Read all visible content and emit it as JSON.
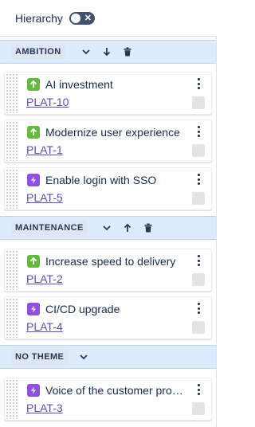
{
  "hierarchy": {
    "label": "Hierarchy",
    "toggle_symbol": "✕"
  },
  "groups": [
    {
      "name": "AMBITION",
      "icons": [
        "chevron-down-icon",
        "arrow-down-icon",
        "trash-icon"
      ],
      "items": [
        {
          "type": "story",
          "title": "AI investment",
          "key": "PLAT-10"
        },
        {
          "type": "story",
          "title": "Modernize user experience",
          "key": "PLAT-1"
        },
        {
          "type": "epic",
          "title": "Enable login with SSO",
          "key": "PLAT-5"
        }
      ]
    },
    {
      "name": "MAINTENANCE",
      "icons": [
        "chevron-down-icon",
        "arrow-up-icon",
        "trash-icon"
      ],
      "items": [
        {
          "type": "story",
          "title": "Increase speed to delivery",
          "key": "PLAT-2"
        },
        {
          "type": "epic",
          "title": "CI/CD upgrade",
          "key": "PLAT-4"
        }
      ]
    },
    {
      "name": "NO THEME",
      "icons": [
        "chevron-down-icon"
      ],
      "items": [
        {
          "type": "epic",
          "title": "Voice of the customer program",
          "key": "PLAT-3"
        }
      ]
    }
  ]
}
